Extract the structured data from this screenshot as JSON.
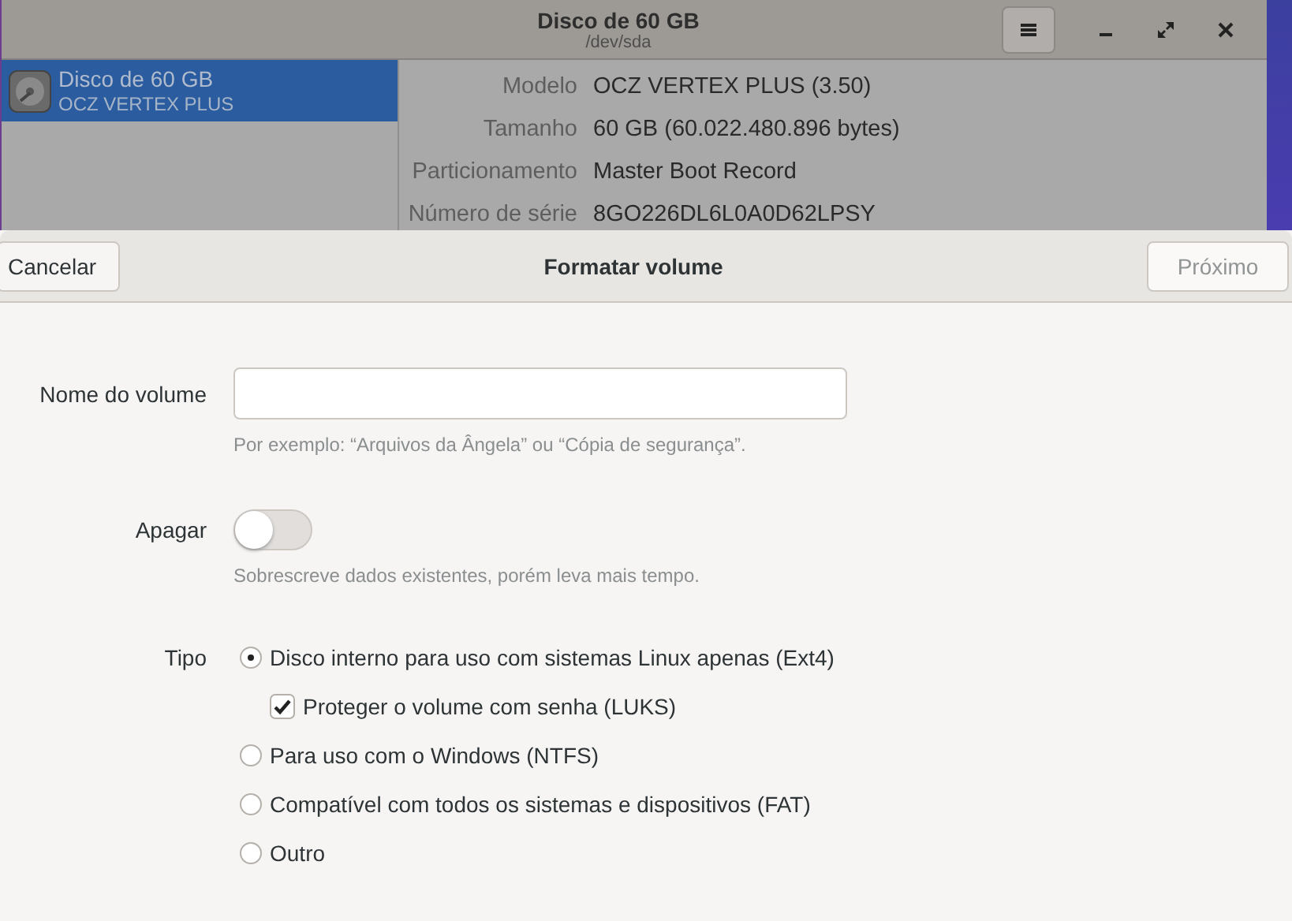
{
  "background_window": {
    "title": "Disco de 60 GB",
    "subtitle": "/dev/sda",
    "sidebar": {
      "items": [
        {
          "name": "Disco de 60 GB",
          "model": "OCZ VERTEX PLUS",
          "selected": true
        }
      ]
    },
    "details": [
      {
        "label": "Modelo",
        "value": "OCZ VERTEX PLUS (3.50)"
      },
      {
        "label": "Tamanho",
        "value": "60 GB (60.022.480.896 bytes)"
      },
      {
        "label": "Particionamento",
        "value": "Master Boot Record"
      },
      {
        "label": "Número de série",
        "value": "8GO226DL6L0A0D62LPSY"
      }
    ]
  },
  "dialog": {
    "title": "Formatar volume",
    "cancel": "Cancelar",
    "next": {
      "label": "Próximo",
      "disabled": true
    },
    "volume_name": {
      "label": "Nome do volume",
      "hint": "Por exemplo: “Arquivos da Ângela” ou “Cópia de segurança”."
    },
    "erase": {
      "label": "Apagar",
      "on": false,
      "hint": "Sobrescreve dados existentes, porém leva mais tempo."
    },
    "type": {
      "label": "Tipo",
      "options": [
        {
          "label": "Disco interno para uso com sistemas Linux apenas (Ext4)",
          "selected": true,
          "children": [
            {
              "kind": "checkbox",
              "label": "Proteger o volume com senha (LUKS)",
              "checked": true
            }
          ]
        },
        {
          "label": "Para uso com o Windows (NTFS)",
          "selected": false
        },
        {
          "label": "Compatível com todos os sistemas e dispositivos (FAT)",
          "selected": false
        },
        {
          "label": "Outro",
          "selected": false
        }
      ]
    }
  }
}
